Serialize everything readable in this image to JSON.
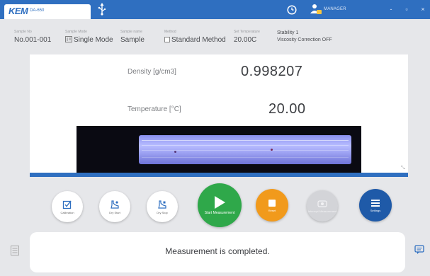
{
  "app": {
    "logo_text": "KEM",
    "model": "DA-650",
    "user_label": "MANAGER",
    "window_buttons": {
      "minimize": "-",
      "maximize": "▫",
      "close": "×"
    }
  },
  "info": {
    "sample_no": {
      "label": "Sample No",
      "value": "No.001-001"
    },
    "sample_mode": {
      "label": "Sample Mode",
      "value": "Single Mode"
    },
    "sample_name": {
      "label": "Sample name",
      "value": "Sample"
    },
    "method": {
      "label": "Method",
      "value": "Standard Method"
    },
    "set_temperature": {
      "label": "Set Temperature",
      "value": "20.00C"
    },
    "stability": "Stability 1",
    "viscosity": "Viscosity Correction OFF"
  },
  "measurement": {
    "density_label": "Density [g/cm3]",
    "density_value": "0.998207",
    "temperature_label": "Temperature [°C]",
    "temperature_value": "20.00",
    "progress": 1.0
  },
  "buttons": {
    "calibration": "Calibration",
    "dry_start": "Dry Start",
    "dry_stop": "Dry Stop",
    "start": "Start Measurement",
    "reset": "Reset",
    "interrupt": "Interrupt Measurement",
    "settings": "Settings"
  },
  "status": {
    "message": "Measurement is completed."
  },
  "colors": {
    "primary": "#2f6fc0",
    "start": "#2fa84a",
    "reset": "#f19a1c",
    "settings": "#1f5aa8",
    "disabled": "#d3d4d8"
  }
}
